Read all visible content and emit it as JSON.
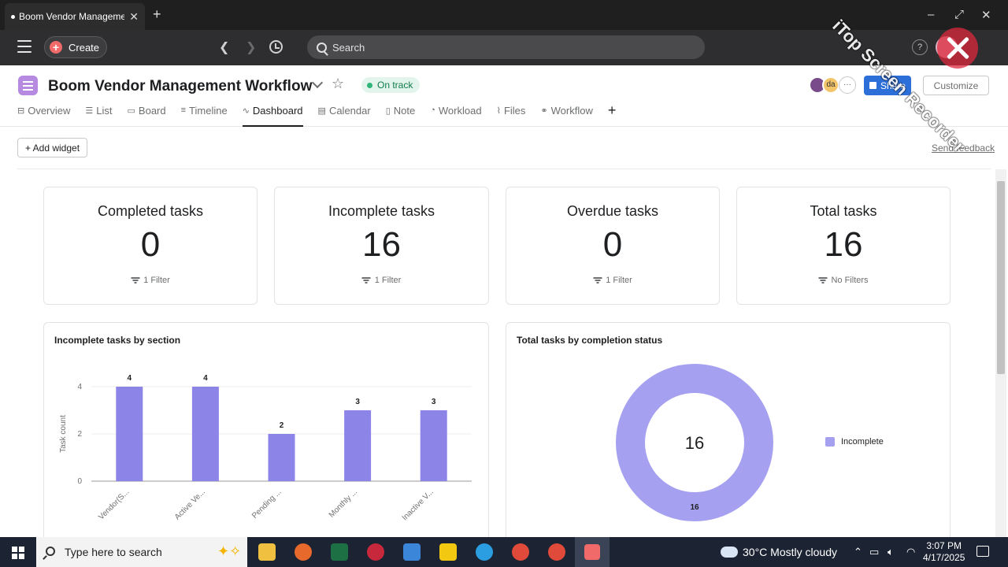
{
  "browser": {
    "tab_title": "Boom Vendor Manageme",
    "new_tab": "+",
    "minimize": "–",
    "maximize": "⤢",
    "close": "✕"
  },
  "topbar": {
    "create_label": "Create",
    "search_placeholder": "Search",
    "help": "?"
  },
  "project": {
    "title": "Boom Vendor Management Workflow",
    "status": "On track",
    "avatars": [
      "",
      "da"
    ],
    "more": "···",
    "share_label": "Share",
    "customize_label": "Customize",
    "tabs": [
      {
        "icon": "⊟",
        "label": "Overview"
      },
      {
        "icon": "☰",
        "label": "List"
      },
      {
        "icon": "▭",
        "label": "Board"
      },
      {
        "icon": "≡",
        "label": "Timeline"
      },
      {
        "icon": "∿",
        "label": "Dashboard",
        "active": true
      },
      {
        "icon": "▤",
        "label": "Calendar"
      },
      {
        "icon": "▯",
        "label": "Note"
      },
      {
        "icon": "◔",
        "label": "Workload"
      },
      {
        "icon": "⌇",
        "label": "Files"
      },
      {
        "icon": "⚭",
        "label": "Workflow"
      }
    ],
    "add_tab": "+"
  },
  "toolbar": {
    "add_widget": "+ Add widget",
    "send_feedback": "Send feedback"
  },
  "cards": [
    {
      "title": "Completed tasks",
      "value": "0",
      "filter": "1 Filter"
    },
    {
      "title": "Incomplete tasks",
      "value": "16",
      "filter": "1 Filter"
    },
    {
      "title": "Overdue tasks",
      "value": "0",
      "filter": "1 Filter"
    },
    {
      "title": "Total tasks",
      "value": "16",
      "filter": "No Filters"
    }
  ],
  "chart_data": [
    {
      "type": "bar",
      "title": "Incomplete tasks by section",
      "ylabel": "Task count",
      "xlabel": "",
      "ylim": [
        0,
        4
      ],
      "yticks": [
        0,
        2,
        4
      ],
      "categories": [
        "Vendor(S...",
        "Active Ve...",
        "Pending ...",
        "Monthly ...",
        "Inactive V..."
      ],
      "values": [
        4,
        4,
        2,
        3,
        3
      ],
      "color": "#8d84e8",
      "grid": true
    },
    {
      "type": "pie",
      "title": "Total tasks by completion status",
      "center_label": "16",
      "slices": [
        {
          "label": "Incomplete",
          "value": 16
        }
      ],
      "color": "#a5a0f0",
      "legend": "right"
    }
  ],
  "taskbar": {
    "search_placeholder": "Type here to search",
    "weather": "30°C  Mostly cloudy",
    "time": "3:07 PM",
    "date": "4/17/2025"
  },
  "watermark": "iTop Screen Recorder"
}
